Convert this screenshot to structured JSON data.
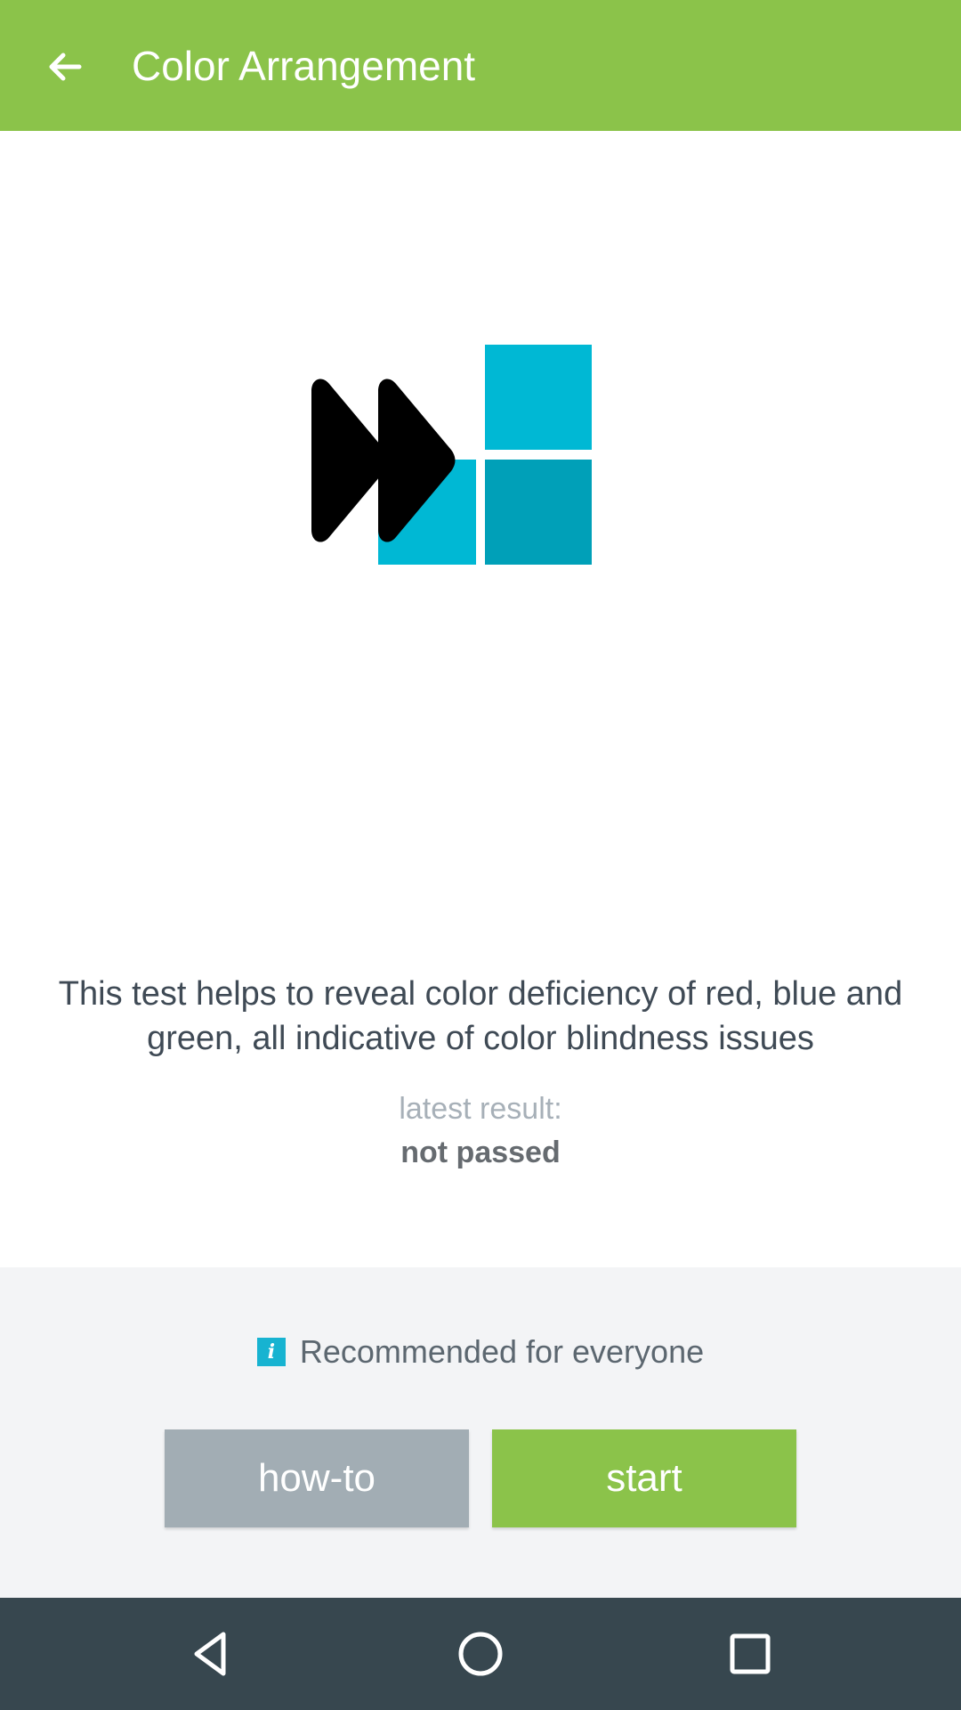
{
  "appbar": {
    "title": "Color Arrangement",
    "background_color": "#8bc34a",
    "back_icon": "arrow-left-icon"
  },
  "main": {
    "illustration": {
      "icon": "fast-forward-color-blocks",
      "colors": {
        "arrows": "#000000",
        "block_light": "#00b8d4",
        "block_dark": "#00a0b8"
      }
    },
    "description": "This test helps to reveal color deficiency of red, blue and green, all indicative of color blindness issues",
    "result_label": "latest result:",
    "result_value": "not passed"
  },
  "footer": {
    "info_icon": "info-icon",
    "recommendation": "Recommended for everyone",
    "howto_label": "how-to",
    "start_label": "start",
    "colors": {
      "howto": "#a2adb4",
      "start": "#8bc34a"
    }
  },
  "navbar": {
    "icons": [
      "nav-back-icon",
      "nav-home-icon",
      "nav-recent-apps-icon"
    ],
    "background_color": "#37474f"
  }
}
